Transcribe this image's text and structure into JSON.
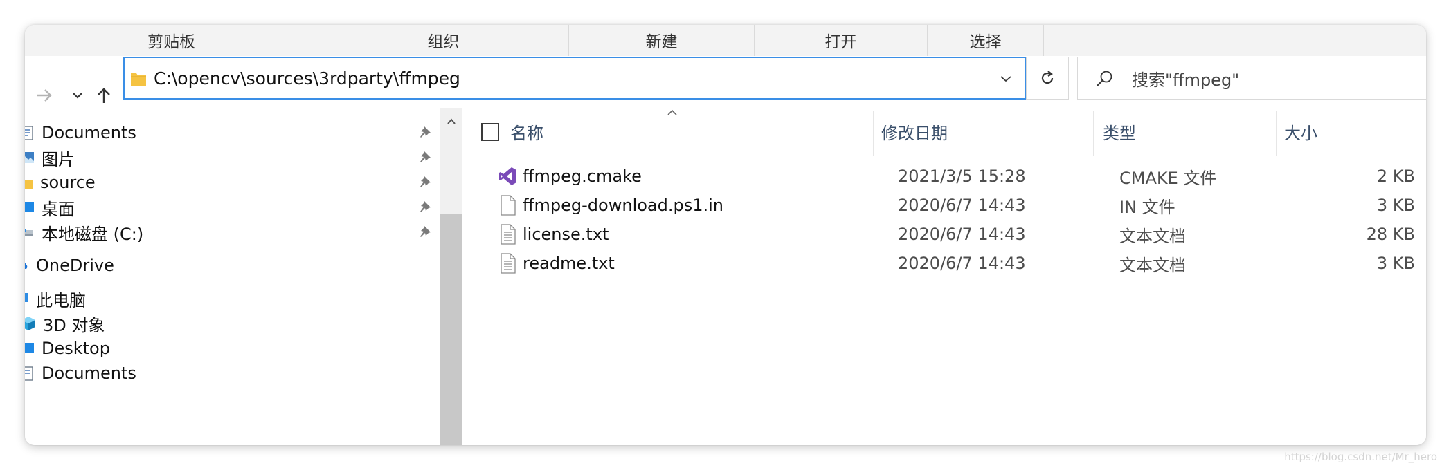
{
  "ribbon": {
    "groups": [
      "剪贴板",
      "组织",
      "新建",
      "打开",
      "选择"
    ]
  },
  "address_bar": {
    "path": "C:\\opencv\\sources\\3rdparty\\ffmpeg",
    "folder_icon": "folder-icon",
    "dropdown_icon": "chevron-down-icon"
  },
  "search": {
    "text": "搜索\"ffmpeg\"",
    "icon": "search-icon"
  },
  "nav_pane": {
    "items": [
      {
        "label": "Documents",
        "icon": "documents-icon",
        "pinned": true
      },
      {
        "label": "图片",
        "icon": "pictures-icon",
        "pinned": true
      },
      {
        "label": "source",
        "icon": "folder-icon",
        "pinned": true
      },
      {
        "label": "桌面",
        "icon": "desktop-icon",
        "pinned": true
      },
      {
        "label": "本地磁盘 (C:)",
        "icon": "drive-icon",
        "pinned": true
      },
      {
        "label": "OneDrive",
        "icon": "onedrive-icon",
        "pinned": false
      },
      {
        "label": "此电脑",
        "icon": "this-pc-icon",
        "pinned": false
      },
      {
        "label": "3D 对象",
        "icon": "3d-objects-icon",
        "pinned": false
      },
      {
        "label": "Desktop",
        "icon": "desktop-icon",
        "pinned": false
      },
      {
        "label": "Documents",
        "icon": "documents-icon",
        "pinned": false
      }
    ]
  },
  "file_list": {
    "columns": {
      "name": "名称",
      "date": "修改日期",
      "type": "类型",
      "size": "大小"
    },
    "files": [
      {
        "name": "ffmpeg.cmake",
        "date": "2021/3/5 15:28",
        "type": "CMAKE 文件",
        "size": "2 KB",
        "icon": "visual-studio-icon"
      },
      {
        "name": "ffmpeg-download.ps1.in",
        "date": "2020/6/7 14:43",
        "type": "IN 文件",
        "size": "3 KB",
        "icon": "blank-file-icon"
      },
      {
        "name": "license.txt",
        "date": "2020/6/7 14:43",
        "type": "文本文档",
        "size": "28 KB",
        "icon": "text-file-icon"
      },
      {
        "name": "readme.txt",
        "date": "2020/6/7 14:43",
        "type": "文本文档",
        "size": "3 KB",
        "icon": "text-file-icon"
      }
    ]
  },
  "watermark": "https://blog.csdn.net/Mr_hero",
  "colors": {
    "address_border": "#3a8ee6",
    "folder_yellow": "#f5c342",
    "vs_purple": "#7a4ab8",
    "header_text": "#3a4f6b",
    "pin": "#7a7a7a"
  }
}
